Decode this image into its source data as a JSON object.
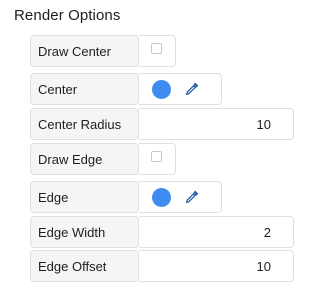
{
  "section": {
    "title": "Render Options"
  },
  "rows": {
    "draw_center": {
      "label": "Draw Center",
      "checked": false
    },
    "center": {
      "label": "Center",
      "color": "#3f8cf0"
    },
    "center_radius": {
      "label": "Center Radius",
      "value": "10"
    },
    "draw_edge": {
      "label": "Draw Edge",
      "checked": false
    },
    "edge": {
      "label": "Edge",
      "color": "#3f8cf0"
    },
    "edge_width": {
      "label": "Edge Width",
      "value": "2"
    },
    "edge_offset": {
      "label": "Edge Offset",
      "value": "10"
    }
  },
  "icons": {
    "eyedropper": "eyedropper-icon",
    "eyedropper_color": "#2b5fa8"
  }
}
